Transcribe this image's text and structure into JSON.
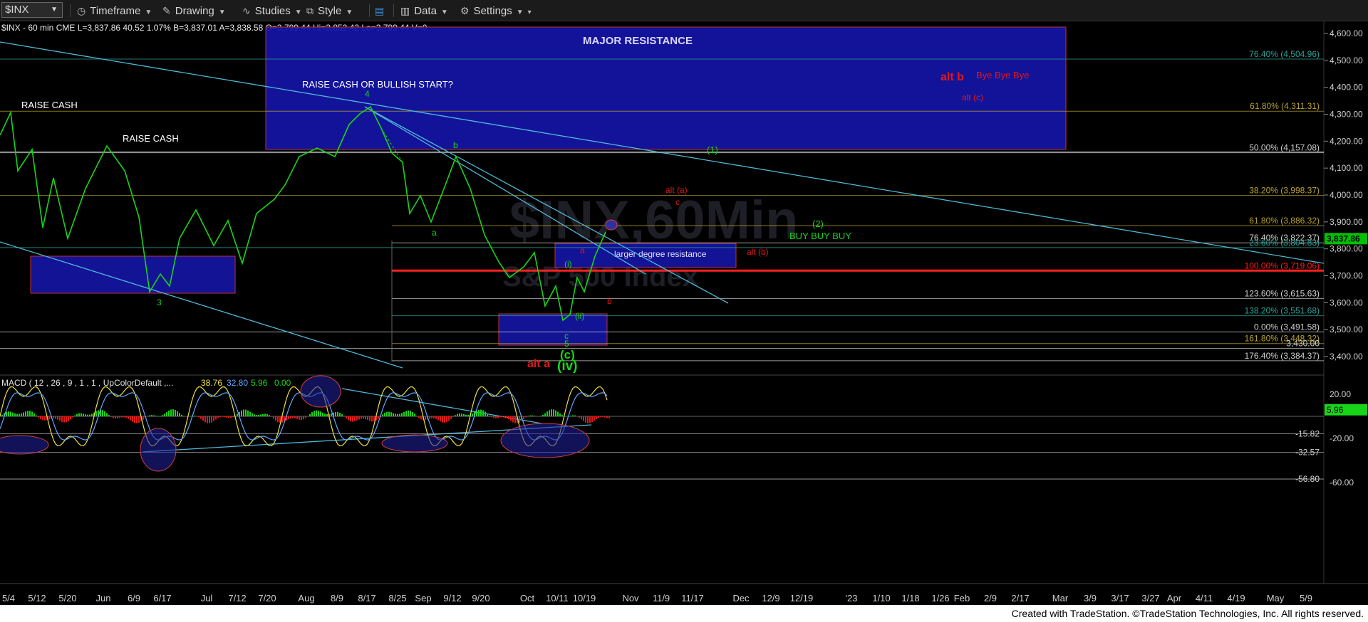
{
  "toolbar": {
    "symbol": "$INX",
    "timeframe": "Timeframe",
    "drawing": "Drawing",
    "studies": "Studies",
    "style": "Style",
    "data": "Data",
    "settings": "Settings"
  },
  "header": {
    "text": "$INX - 60 min  CME  L=3,837.86  40.52  1.07%  B=3,837.01  A=3,838.58  O=3,799.44  Hi=3,852.42  Lo=3,799.44  V=0"
  },
  "watermark": {
    "line1": "$INX,60Min",
    "line2": "S&P 500 Index"
  },
  "price_axis": {
    "ticks": [
      "4,600.00",
      "4,500.00",
      "4,400.00",
      "4,300.00",
      "4,200.00",
      "4,100.00",
      "4,000.00",
      "3,900.00",
      "3,800.00",
      "3,700.00",
      "3,600.00",
      "3,500.00",
      "3,400.00"
    ],
    "last_price": "3,837.86",
    "last_price_color": "#00c000"
  },
  "macd_axis": {
    "ticks": [
      "20.00",
      "-20.00",
      "-60.00"
    ],
    "levels": [
      "-15.82",
      "-32.57",
      "-56.80"
    ],
    "last_value": "5.96"
  },
  "time_axis": {
    "labels": [
      "5/4",
      "5/12",
      "5/20",
      "Jun",
      "6/9",
      "6/17",
      "Jul",
      "7/12",
      "7/20",
      "Aug",
      "8/9",
      "8/17",
      "8/25",
      "Sep",
      "9/12",
      "9/20",
      "Oct",
      "10/11",
      "10/19",
      "Nov",
      "11/9",
      "11/17",
      "Dec",
      "12/9",
      "12/19",
      "'23",
      "1/10",
      "1/18",
      "1/26",
      "Feb",
      "2/9",
      "2/17",
      "Mar",
      "3/9",
      "3/17",
      "3/27",
      "Apr",
      "4/11",
      "4/19",
      "May",
      "5/9"
    ]
  },
  "fib_levels": [
    {
      "label": "76.40% (4,504.96)",
      "color": "#2aa198"
    },
    {
      "label": "61.80% (4,311.31)",
      "color": "#b8a22c"
    },
    {
      "label": "50.00% (4,157.08)",
      "color": "#cfcfcf"
    },
    {
      "label": "38.20% (3,998.37)",
      "color": "#b8a22c"
    },
    {
      "label": "61.80% (3,886.32)",
      "color": "#b8a22c"
    },
    {
      "label": "76.40% (3,822.37)",
      "color": "#cfcfcf"
    },
    {
      "label": "23.60% (3,804.83)",
      "color": "#2aa198"
    },
    {
      "label": "100.00% (3,719.06)",
      "color": "#ff2020"
    },
    {
      "label": "123.60% (3,615.63)",
      "color": "#cfcfcf"
    },
    {
      "label": "138.20% (3,551.68)",
      "color": "#2aa198"
    },
    {
      "label": "0.00% (3,491.58)",
      "color": "#cfcfcf"
    },
    {
      "label": "161.80% (3,448.32)",
      "color": "#b8a22c"
    },
    {
      "label": "3,430.00",
      "color": "#cfcfcf"
    },
    {
      "label": "176.40% (3,384.37)",
      "color": "#cfcfcf"
    }
  ],
  "boxes": {
    "major_resistance": "MAJOR RESISTANCE",
    "larger_degree": "larger degree resistance"
  },
  "annotations": {
    "raise_cash_1": "RAISE CASH",
    "raise_cash_2": "RAISE CASH",
    "raise_cash_bullish": "RAISE CASH OR BULLISH START?",
    "wave_4": "4",
    "wave_3": "3",
    "wave_b_green": "b",
    "wave_a_green": "a",
    "wave_1": "(1)",
    "wave_2": "(2)",
    "buy_buy_buy": "BUY BUY BUY",
    "alt_b": "alt b",
    "bye_bye_bye": "Bye Bye Bye",
    "alt_c": "alt (c)",
    "alt_a_paren": "alt (a)",
    "red_c": "c",
    "alt_b_paren": "alt (b)",
    "red_a": "a",
    "red_b": "b",
    "wave_i": "(i)",
    "wave_ii": "(ii)",
    "wave_c_small": "c",
    "wave_5": "5",
    "wave_c_circle": "(c)",
    "wave_iv": "(iv)",
    "alt_a": "alt a"
  },
  "macd_header": {
    "label": "MACD ( 12 , 26 , 9 , 1 , 1 , UpColorDefault ,...",
    "v1": "38.76",
    "v2": "32.80",
    "v3": "5.96",
    "v4": "0.00"
  },
  "footer": "Created with TradeStation. ©TradeStation Technologies, Inc. All rights reserved."
}
